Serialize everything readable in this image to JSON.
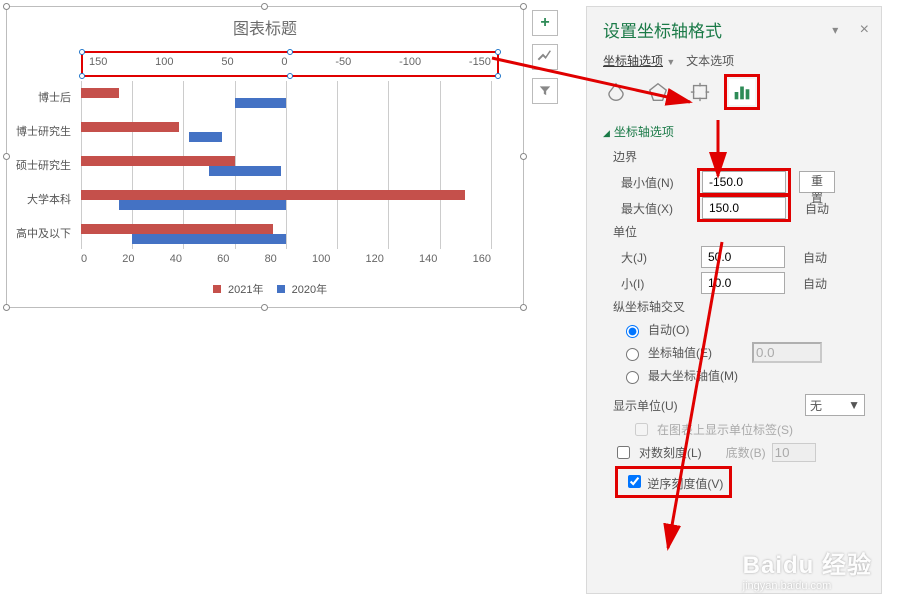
{
  "chart": {
    "title": "图表标题",
    "secondary_axis_ticks": [
      "150",
      "100",
      "50",
      "0",
      "-50",
      "-100",
      "-150"
    ],
    "x_ticks": [
      "0",
      "20",
      "40",
      "60",
      "80",
      "100",
      "120",
      "140",
      "160"
    ],
    "categories": [
      "博士后",
      "博士研究生",
      "硕士研究生",
      "大学本科",
      "高中及以下"
    ],
    "legend": {
      "s2021": "2021年",
      "s2020": "2020年"
    }
  },
  "side_buttons": {
    "plus": "+",
    "brush": "✎",
    "funnel": "▾"
  },
  "panel": {
    "title": "设置坐标轴格式",
    "close": "×",
    "dropdown_glyph": "▾",
    "tabs": {
      "axis": "坐标轴选项",
      "text": "文本选项"
    },
    "section": "坐标轴选项",
    "bounds_label": "边界",
    "min_label": "最小值(N)",
    "min_value": "-150.0",
    "reset_label": "重置",
    "max_label": "最大值(X)",
    "max_value": "150.0",
    "auto_label": "自动",
    "units_label": "单位",
    "major_label": "大(J)",
    "major_value": "50.0",
    "minor_label": "小(I)",
    "minor_value": "10.0",
    "cross_label": "纵坐标轴交叉",
    "cross_auto": "自动(O)",
    "cross_value": "坐标轴值(E)",
    "cross_value_input": "0.0",
    "cross_max": "最大坐标轴值(M)",
    "display_units_label": "显示单位(U)",
    "display_units_value": "无",
    "show_units_label": "在图表上显示单位标签(S)",
    "log_scale": "对数刻度(L)",
    "log_base_label": "底数(B)",
    "log_base_value": "10",
    "reverse": "逆序刻度值(V)"
  },
  "watermark": {
    "big": "Baidu 经验",
    "small": "jingyan.baidu.com"
  },
  "chart_data": {
    "type": "bar",
    "orientation": "horizontal",
    "categories": [
      "博士后",
      "博士研究生",
      "硕士研究生",
      "大学本科",
      "高中及以下"
    ],
    "series": [
      {
        "name": "2021年",
        "color": "#c5504b",
        "values": [
          15,
          38,
          60,
          150,
          75
        ]
      },
      {
        "name": "2020年",
        "color": "#4472c4",
        "values": [
          80,
          55,
          78,
          80,
          80
        ]
      }
    ],
    "bar_starts_2020": [
      60,
      42,
      50,
      15,
      20
    ],
    "primary_axis": {
      "min": 0,
      "max": 160,
      "major": 20
    },
    "secondary_axis": {
      "min": -150,
      "max": 150,
      "major": 50,
      "reversed": true
    },
    "title": "图表标题",
    "legend_position": "bottom"
  }
}
